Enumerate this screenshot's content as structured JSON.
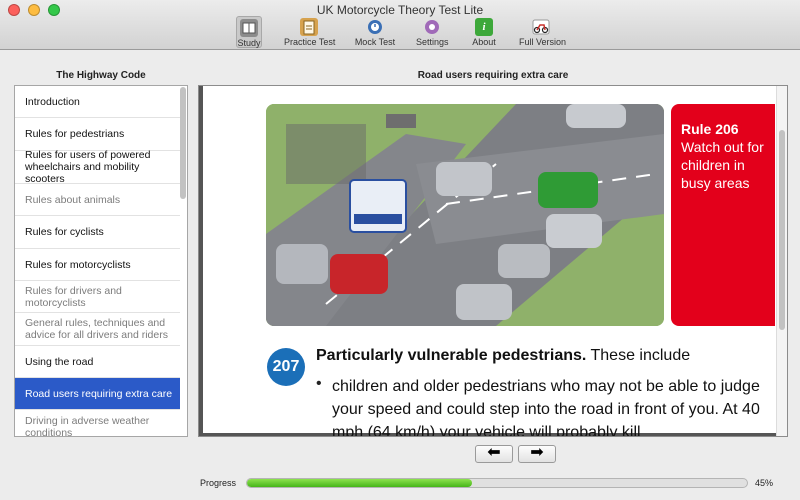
{
  "window": {
    "title": "UK Motorcycle Theory Test Lite"
  },
  "toolbar": {
    "items": [
      {
        "label": "Study",
        "icon": "book-icon",
        "color": "#8c8c8c",
        "active": true
      },
      {
        "label": "Practice Test",
        "icon": "clipboard-icon",
        "color": "#d6a24e"
      },
      {
        "label": "Mock Test",
        "icon": "clock-icon",
        "color": "#3a6fb5"
      },
      {
        "label": "Settings",
        "icon": "gear-icon",
        "color": "#a06ab8"
      },
      {
        "label": "About",
        "icon": "info-icon",
        "color": "#3da83a"
      },
      {
        "label": "Full Version",
        "icon": "motorcycle-icon",
        "color": "#c9302c"
      }
    ]
  },
  "sidebar": {
    "title": "The Highway Code",
    "items": [
      {
        "label": "Introduction",
        "dim": false
      },
      {
        "label": "Rules for pedestrians",
        "dim": false
      },
      {
        "label": "Rules for users of powered wheelchairs and mobility scooters",
        "dim": false
      },
      {
        "label": "Rules about animals",
        "dim": true
      },
      {
        "label": "Rules for cyclists",
        "dim": false
      },
      {
        "label": "Rules for motorcyclists",
        "dim": false
      },
      {
        "label": "Rules for drivers and motorcyclists",
        "dim": true
      },
      {
        "label": "General rules, techniques and advice for all drivers and riders",
        "dim": true
      },
      {
        "label": "Using the road",
        "dim": false
      },
      {
        "label": "Road users requiring extra care",
        "dim": false,
        "selected": true
      },
      {
        "label": "Driving in adverse weather conditions",
        "dim": true
      }
    ]
  },
  "main": {
    "title": "Road users requiring extra care",
    "rule_box": {
      "number": "Rule 206",
      "text": "Watch out for children in busy areas",
      "color": "#e3001b"
    },
    "rule": {
      "number": "207",
      "heading_bold": "Particularly vulnerable pedestrians.",
      "heading_rest": " These include",
      "bullet_text": "children and older pedestrians who may not be able to judge your speed and could step into the road in front of you. At 40 mph (64 km/h) your vehicle will probably kill"
    },
    "badge_color": "#1b6fb8"
  },
  "nav": {
    "prev": "⬅",
    "next": "➡"
  },
  "progress": {
    "label": "Progress",
    "value_pct": 45,
    "value_text": "45%"
  }
}
